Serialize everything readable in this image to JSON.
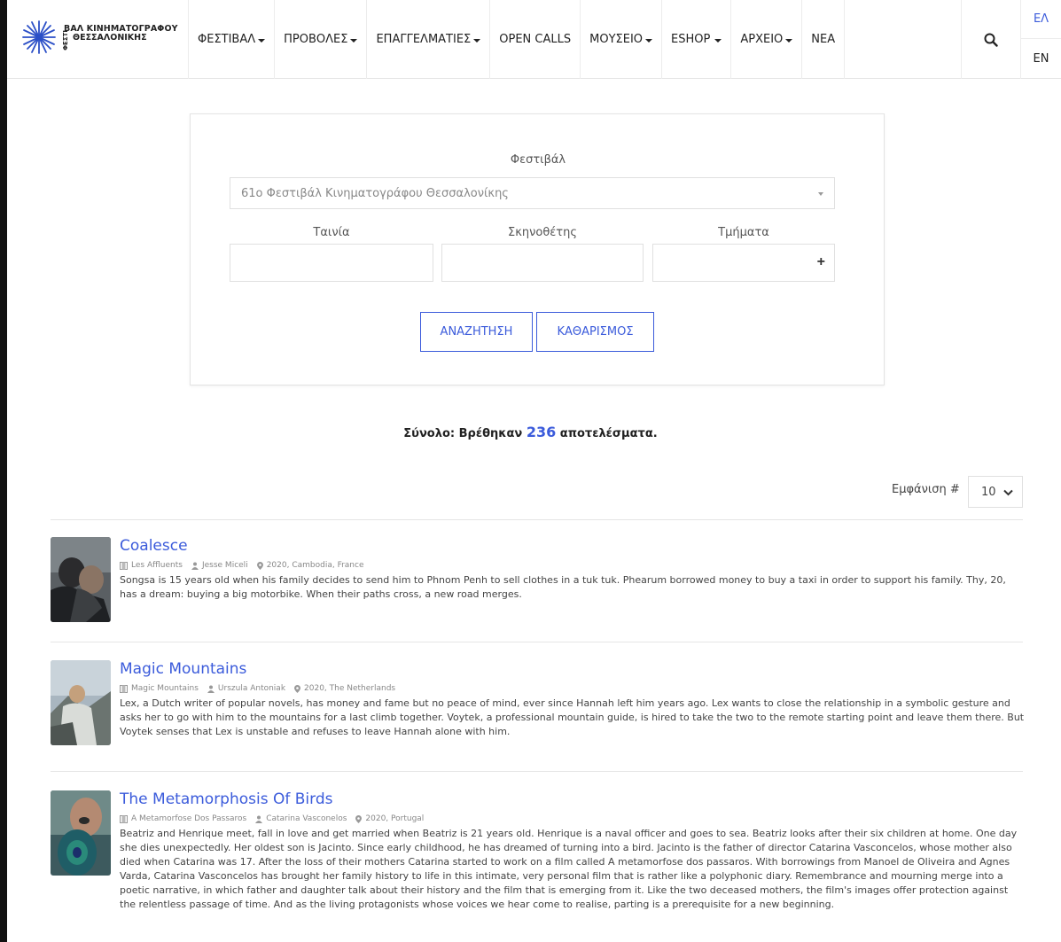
{
  "header": {
    "logo_line1": "ΒΑΛ ΚΙΝΗΜΑΤΟΓΡΑΦΟΥ",
    "logo_line2": "ΘΕΣΣΑΛΟΝΙΚΗΣ",
    "logo_vertical": "ΦΕΣΤΙ",
    "nav": [
      {
        "label": "ΦΕΣΤΙΒΑΛ",
        "dropdown": true
      },
      {
        "label": "ΠΡΟΒΟΛΕΣ",
        "dropdown": true
      },
      {
        "label": "ΕΠΑΓΓΕΛΜΑΤΙΕΣ",
        "dropdown": true
      },
      {
        "label": "OPEN CALLS",
        "dropdown": false
      },
      {
        "label": "ΜΟΥΣΕΙΟ",
        "dropdown": true
      },
      {
        "label": "ESHOP",
        "dropdown": true
      },
      {
        "label": "ΑΡΧΕΙΟ",
        "dropdown": true
      },
      {
        "label": "ΝΕΑ",
        "dropdown": false
      }
    ],
    "search_icon": "search-icon",
    "lang_el": "ΕΛ",
    "lang_en": "EN"
  },
  "filters": {
    "festival_label": "Φεστιβάλ",
    "festival_value": "61ο Φεστιβάλ Κινηματογράφου Θεσσαλονίκης",
    "film_label": "Ταινία",
    "director_label": "Σκηνοθέτης",
    "sections_label": "Τμήματα",
    "sections_plus": "+",
    "search_button": "ΑΝΑΖΗΤΗΣΗ",
    "clear_button": "ΚΑΘΑΡΙΣΜΟΣ"
  },
  "results": {
    "total_prefix": "Σύνολο: Βρέθηκαν",
    "total_count": "236",
    "total_suffix": "αποτελέσματα.",
    "per_page_label": "Εμφάνιση #",
    "per_page_value": "10"
  },
  "films": [
    {
      "title": "Coalesce",
      "original_title": "Les Affluents",
      "director": "Jesse Miceli",
      "year_country": "2020, Cambodia, France",
      "description": "Songsa is 15 years old when his family decides to send him to Phnom Penh to sell clothes in a tuk tuk. Phearum borrowed money to buy a taxi in order to support his family. Thy, 20, has a dream: buying a big motorbike. When their paths cross, a new road merges."
    },
    {
      "title": "Magic Mountains",
      "original_title": "Magic Mountains",
      "director": "Urszula Antoniak",
      "year_country": "2020, The Netherlands",
      "description": "Lex, a Dutch writer of popular novels, has money and fame but no peace of mind, ever since Hannah left him years ago. Lex wants to close the relationship in a symbolic gesture and asks her to go with him to the mountains for a last climb together. Voytek, a professional mountain guide, is hired to take the two to the remote starting point and leave them there. But Voytek senses that Lex is unstable and refuses to leave Hannah alone with him."
    },
    {
      "title": "The Metamorphosis Of Birds",
      "original_title": "A Metamorfose Dos Passaros",
      "director": "Catarina Vasconelos",
      "year_country": "2020, Portugal",
      "description": "Beatriz and Henrique meet, fall in love and get married when Beatriz is 21 years old. Henrique is a naval officer and goes to sea. Beatriz looks after their six children at home. One day she dies unexpectedly. Her oldest son is Jacinto. Since early childhood, he has dreamed of turning into a bird. Jacinto is the father of director Catarina Vasconcelos, whose mother also died when Catarina was 17. After the loss of their mothers Catarina started to work on a film called A metamorfose dos passaros. With borrowings from Manoel de Oliveira and Agnes Varda, Catarina Vasconcelos has brought her family history to life in this intimate, very personal film that is rather like a polyphonic diary. Remembrance and mourning merge into a poetic narrative, in which father and daughter talk about their history and the film that is emerging from it. Like the two deceased mothers, the film's images offer protection against the relentless passage of time. And as the living protagonists whose voices we hear come to realise, parting is a prerequisite for a new beginning."
    }
  ],
  "colors": {
    "accent": "#3b5bdb",
    "border": "#e0e0e0"
  }
}
